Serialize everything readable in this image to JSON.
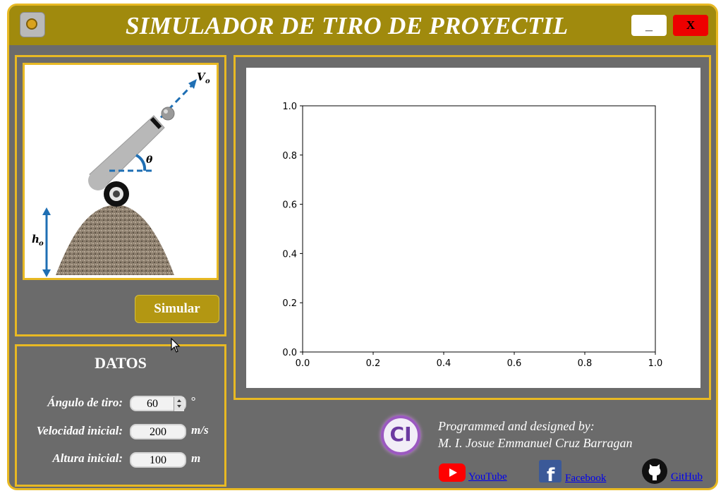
{
  "window": {
    "title": "SIMULADOR DE TIRO DE PROYECTIL",
    "minimize_label": "_",
    "close_label": "X"
  },
  "diagram": {
    "velocity_label": "V",
    "velocity_sub": "o",
    "angle_label": "θ",
    "height_label": "h",
    "height_sub": "o"
  },
  "simulate_button": "Simular",
  "datos": {
    "title": "DATOS",
    "angle": {
      "label": "Ángulo de tiro:",
      "value": "60",
      "unit": "°"
    },
    "velocity": {
      "label": "Velocidad inicial:",
      "value": "200",
      "unit": "m/s"
    },
    "height": {
      "label": "Altura inicial:",
      "value": "100",
      "unit": "m"
    }
  },
  "chart_data": {
    "type": "line",
    "title": "",
    "xlabel": "",
    "ylabel": "",
    "xlim": [
      0,
      1
    ],
    "ylim": [
      0,
      1
    ],
    "x_ticks": [
      "0.0",
      "0.2",
      "0.4",
      "0.6",
      "0.8",
      "1.0"
    ],
    "y_ticks": [
      "0.0",
      "0.2",
      "0.4",
      "0.6",
      "0.8",
      "1.0"
    ],
    "series": []
  },
  "credits": {
    "logo_text": "CI",
    "line1": "Programmed and designed by:",
    "line2": "M. I. Josue Emmanuel Cruz Barragan",
    "youtube": "YouTube",
    "facebook": "Facebook",
    "github": "GitHub"
  },
  "colors": {
    "frame_yellow": "#e8b923",
    "titlebar": "#a08a0d",
    "background": "#6b6b6b",
    "vector_blue": "#1f6fb4"
  }
}
